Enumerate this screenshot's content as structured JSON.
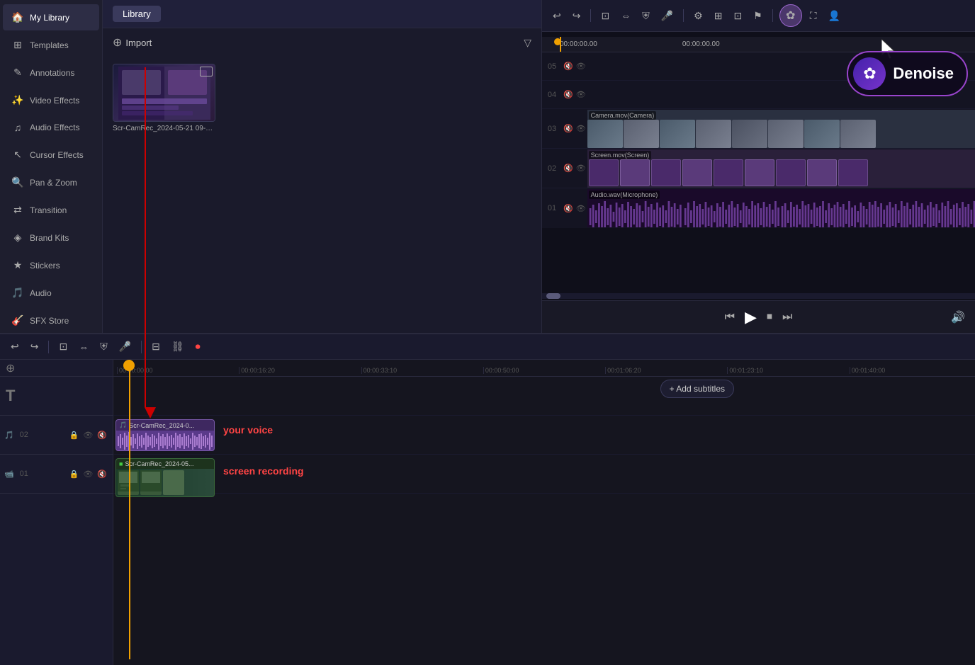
{
  "sidebar": {
    "items": [
      {
        "id": "my-library",
        "label": "My Library",
        "icon": "🏠",
        "active": true
      },
      {
        "id": "templates",
        "label": "Templates",
        "icon": "⊞"
      },
      {
        "id": "annotations",
        "label": "Annotations",
        "icon": "✎"
      },
      {
        "id": "video-effects",
        "label": "Video Effects",
        "icon": "✨"
      },
      {
        "id": "audio-effects",
        "label": "Audio Effects",
        "icon": "♫"
      },
      {
        "id": "cursor-effects",
        "label": "Cursor Effects",
        "icon": "↖"
      },
      {
        "id": "pan-zoom",
        "label": "Pan & Zoom",
        "icon": "🔍"
      },
      {
        "id": "transition",
        "label": "Transition",
        "icon": "⇄"
      },
      {
        "id": "brand-kits",
        "label": "Brand Kits",
        "icon": "◈"
      },
      {
        "id": "stickers",
        "label": "Stickers",
        "icon": "★"
      },
      {
        "id": "audio",
        "label": "Audio",
        "icon": "🎵"
      },
      {
        "id": "sfx-store",
        "label": "SFX Store",
        "icon": "🎸"
      }
    ]
  },
  "library": {
    "tab_label": "Library",
    "import_label": "Import",
    "media_items": [
      {
        "name": "Scr-CamRec_2024-05-21 09-28..."
      }
    ]
  },
  "preview": {
    "time_current": "00:00:00.00",
    "time_total": "00:00:00.00",
    "track_labels": [
      "Camera.mov(Camera)",
      "Screen.mov(Screen)",
      "Audio.wav(Microphone)"
    ],
    "ruler_marks": [
      "00:00:00:00",
      "00:00:00:00"
    ],
    "denoise_label": "Denoise",
    "track_numbers": [
      "05",
      "04",
      "03",
      "02",
      "01"
    ]
  },
  "timeline": {
    "ruler_marks": [
      "00:00:00:00",
      "00:00:16:20",
      "00:00:33:10",
      "00:00:50:00",
      "00:01:06:20",
      "00:01:23:10",
      "00:01:40:00"
    ],
    "add_subtitles_label": "+ Add subtitles",
    "clips": [
      {
        "id": "audio-clip",
        "label": "Scr-CamRec_2024-0...",
        "track": 2,
        "type": "audio"
      },
      {
        "id": "screen-clip",
        "label": "Scr-CamRec_2024-05-...",
        "track": 1,
        "type": "screen"
      }
    ],
    "annotations": [
      {
        "text": "your voice",
        "track": 2
      },
      {
        "text": "screen recording",
        "track": 1
      }
    ],
    "track_rows": [
      {
        "num": "02",
        "icon": "🎵"
      },
      {
        "num": "01",
        "icon": "📹"
      }
    ]
  },
  "toolbar": {
    "undo_label": "↩",
    "redo_label": "↪"
  }
}
